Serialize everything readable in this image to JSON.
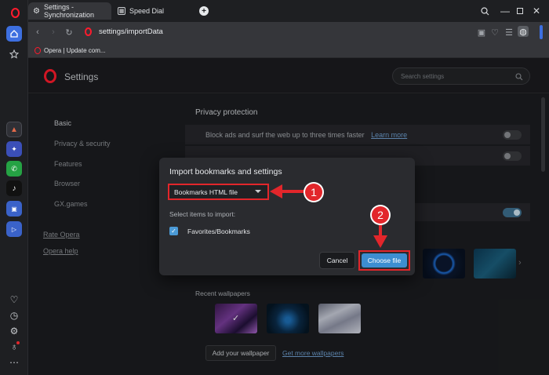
{
  "tabs": [
    {
      "label": "Settings - Synchronization",
      "active": true,
      "icon": "gear-icon"
    },
    {
      "label": "Speed Dial",
      "active": false,
      "icon": "grid-icon"
    }
  ],
  "new_tab_symbol": "+",
  "address": {
    "url": "settings/importData"
  },
  "bookmarks_bar": [
    {
      "label": "Opera | Update com..."
    }
  ],
  "sidebar": {
    "apps": [
      "aria-icon",
      "messenger-icon",
      "whatsapp-icon",
      "tiktok-icon",
      "wallet-icon",
      "player-icon"
    ],
    "bottom": [
      "heart-icon",
      "history-icon",
      "gear-icon",
      "lightbulb-icon",
      "more-icon"
    ],
    "more_symbol": "⋯"
  },
  "settings": {
    "title": "Settings",
    "search_placeholder": "Search settings",
    "nav": [
      {
        "label": "Basic"
      },
      {
        "label": "Privacy & security"
      },
      {
        "label": "Features"
      },
      {
        "label": "Browser"
      },
      {
        "label": "GX.games"
      }
    ],
    "links": [
      {
        "label": "Rate Opera"
      },
      {
        "label": "Opera help"
      }
    ],
    "privacy_title": "Privacy protection",
    "block_ads_text": "Block ads and surf the web up to three times faster",
    "learn_more": "Learn more",
    "recent_wallpapers": "Recent wallpapers",
    "add_wallpaper": "Add your wallpaper",
    "get_more_wallpapers": "Get more wallpapers"
  },
  "dialog": {
    "title": "Import bookmarks and settings",
    "source_selected": "Bookmarks HTML file",
    "select_items_label": "Select items to import:",
    "items": [
      {
        "label": "Favorites/Bookmarks",
        "checked": true
      }
    ],
    "cancel_label": "Cancel",
    "choose_label": "Choose file"
  },
  "callouts": {
    "step1": "1",
    "step2": "2"
  },
  "colors": {
    "accent_red": "#e2262b",
    "primary_blue": "#3d8ed1",
    "opera_red": "#ff1b2d"
  }
}
